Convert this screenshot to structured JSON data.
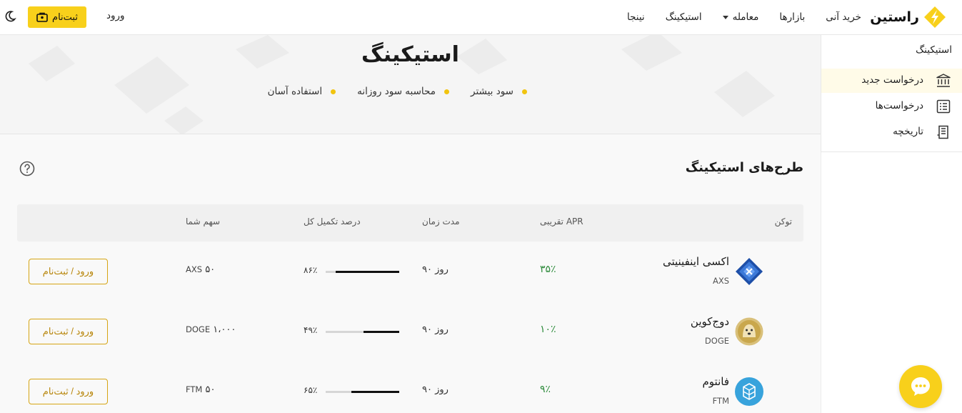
{
  "header": {
    "logo_text": "راستین",
    "nav": [
      {
        "label": "خرید آنی"
      },
      {
        "label": "بازارها"
      },
      {
        "label": "معامله"
      },
      {
        "label": "استیکینگ"
      },
      {
        "label": "نینجا"
      }
    ],
    "login_label": "ورود",
    "signup_label": "ثبت‌نام"
  },
  "sidebar": {
    "title": "استیکینگ",
    "items": [
      {
        "label": "درخواست جدید",
        "icon": "bank-icon",
        "active": true
      },
      {
        "label": "درخواست‌ها",
        "icon": "list-icon",
        "active": false
      },
      {
        "label": "تاریخچه",
        "icon": "receipt-icon",
        "active": false
      }
    ]
  },
  "hero": {
    "title": "استیکینگ",
    "features": [
      "سود بیشتر",
      "محاسبه سود روزانه",
      "استفاده آسان"
    ]
  },
  "plans": {
    "title": "طرح‌های استیکینگ",
    "columns": {
      "token": "توکن",
      "apr": "APR تقریبی",
      "duration": "مدت زمان",
      "completion": "درصد تکمیل کل",
      "share": "سهم شما"
    },
    "rows": [
      {
        "name": "اکسی اینفینیتی",
        "symbol": "AXS",
        "apr": "۳۵٪",
        "duration_value": "۹۰",
        "duration_unit": "روز",
        "progress_label": "۸۶٪",
        "progress": 86,
        "share_value": "۵۰",
        "share_symbol": "AXS",
        "action": "ورود / ثبت‌نام",
        "icon_color": "#1e4fa8"
      },
      {
        "name": "دوج‌کوین",
        "symbol": "DOGE",
        "apr": "۱۰٪",
        "duration_value": "۹۰",
        "duration_unit": "روز",
        "progress_label": "۴۹٪",
        "progress": 49,
        "share_value": "۱،۰۰۰",
        "share_symbol": "DOGE",
        "action": "ورود / ثبت‌نام",
        "icon_color": "#c9a74c"
      },
      {
        "name": "فانتوم",
        "symbol": "FTM",
        "apr": "۹٪",
        "duration_value": "۹۰",
        "duration_unit": "روز",
        "progress_label": "۶۵٪",
        "progress": 65,
        "share_value": "۵۰",
        "share_symbol": "FTM",
        "action": "ورود / ثبت‌نام",
        "icon_color": "#38a3dc"
      }
    ]
  },
  "colors": {
    "accent": "#f8d01b",
    "apr_green": "#2e8b3c",
    "button_border": "#d6a514"
  }
}
